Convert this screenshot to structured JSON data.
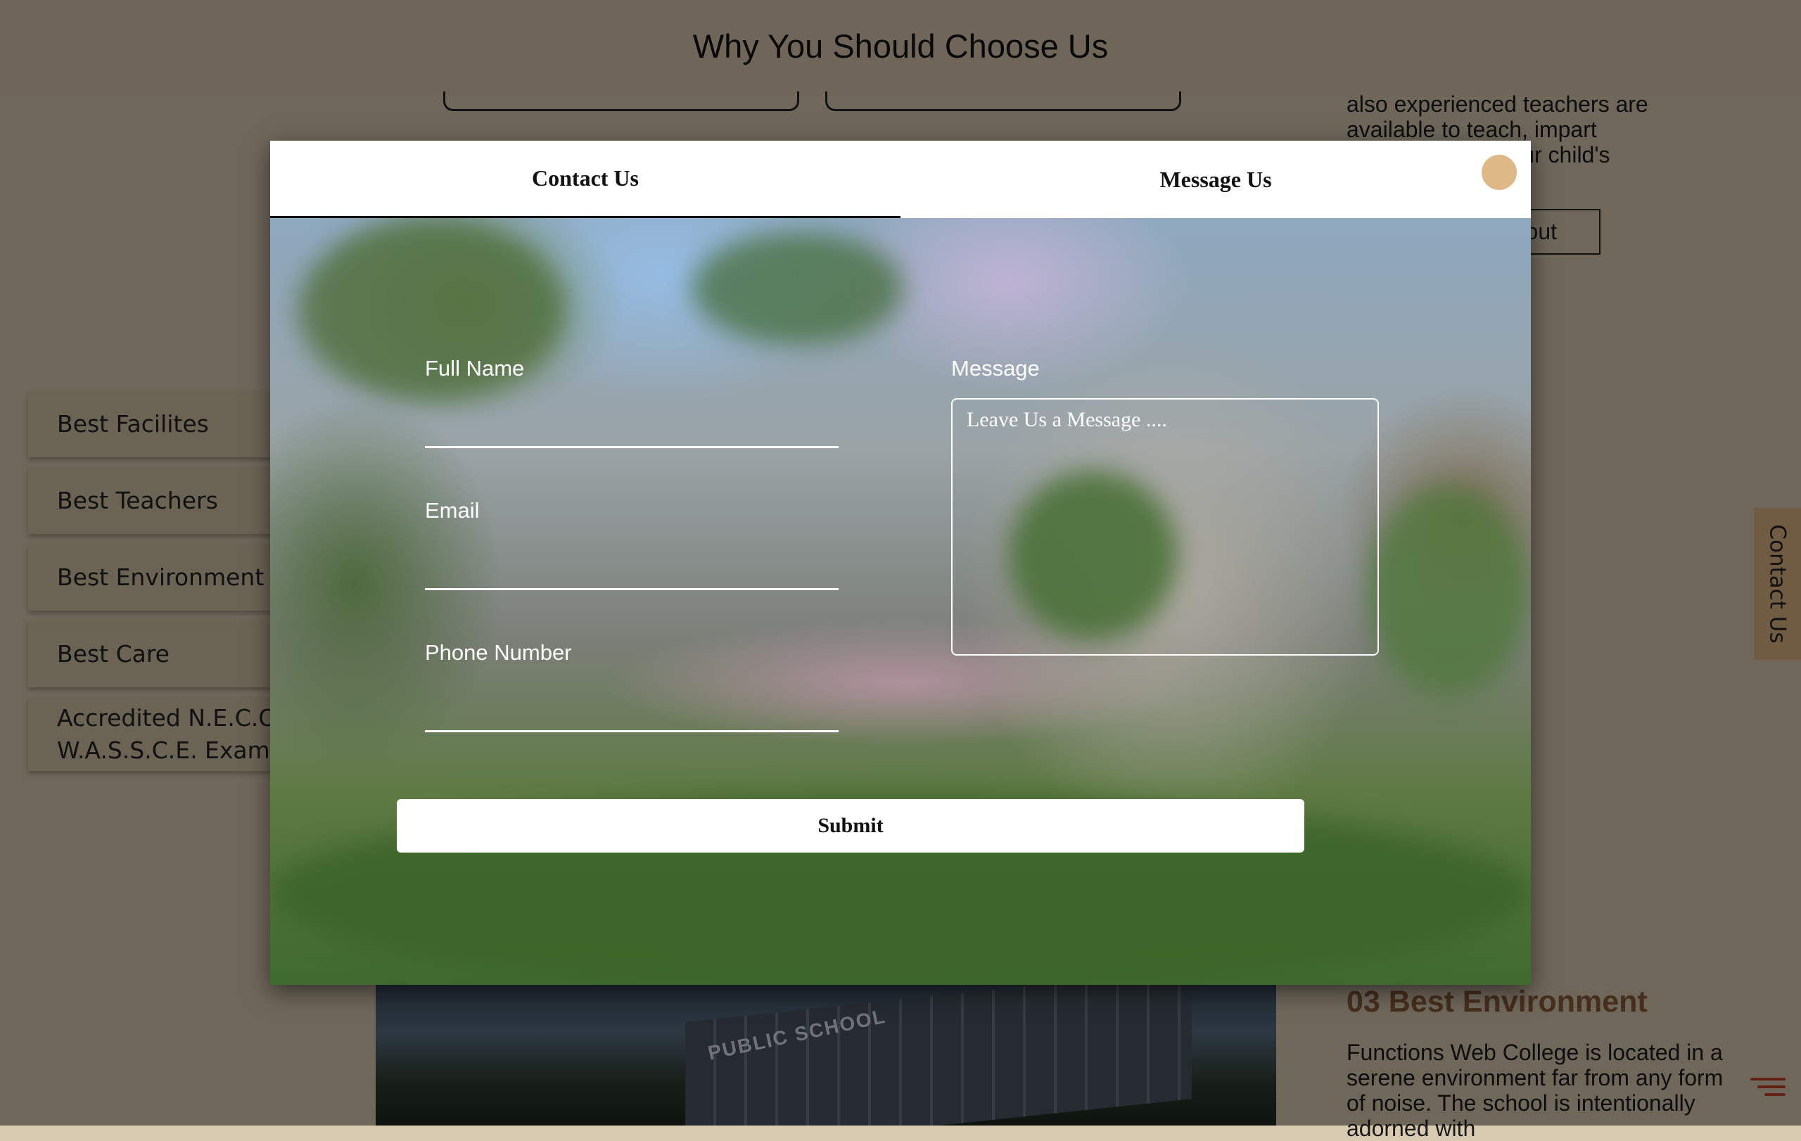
{
  "header": {
    "title": "Why You Should Choose Us"
  },
  "sidebar": {
    "items": [
      {
        "label": "Best Facilites"
      },
      {
        "label": "Best Teachers"
      },
      {
        "label": "Best Environment"
      },
      {
        "label": "Best Care"
      },
      {
        "label_line1": "Accredited N.E.C.O.",
        "label_line2": "W.A.S.S.C.E. Exam C"
      }
    ]
  },
  "right_column": {
    "teachers_text_line1": "also experienced teachers are",
    "teachers_text_line2": "available to teach, impart",
    "teachers_text_line3": "velop your child's",
    "about_button": "out",
    "env_title": "03 Best Environment",
    "env_text": "Functions Web College is located in a serene environment far from any form of noise. The school is intentionally adorned with"
  },
  "background_image": {
    "sign_text": "PUBLIC SCHOOL"
  },
  "contact_tab": {
    "label": "Contact Us"
  },
  "modal": {
    "tabs": [
      {
        "label": "Contact Us"
      },
      {
        "label": "Message Us"
      }
    ],
    "fields": {
      "full_name_label": "Full Name",
      "email_label": "Email",
      "phone_label": "Phone Number",
      "message_label": "Message",
      "message_placeholder": "Leave Us a Message ...."
    },
    "submit_label": "Submit"
  },
  "colors": {
    "header_bg": "#d9c9ae",
    "accent": "#deb887",
    "contact_tab_bg": "#dcb483",
    "env_title": "#8a5a3a"
  }
}
